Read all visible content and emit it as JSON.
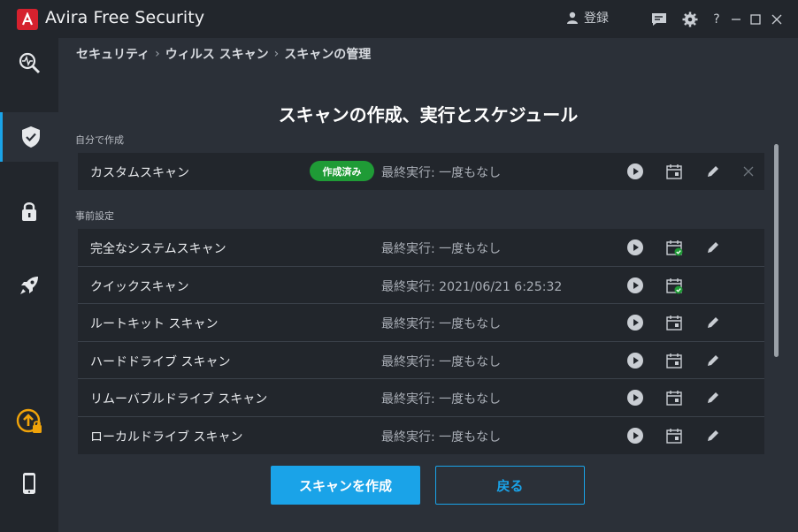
{
  "app": {
    "title_brand": "Avira",
    "title_product": "Free Security",
    "login_label": "登録"
  },
  "breadcrumb": [
    "セキュリティ",
    "ウィルス スキャン",
    "スキャンの管理"
  ],
  "page_title": "スキャンの作成、実行とスケジュール",
  "sections": {
    "custom_label": "自分で作成",
    "preset_label": "事前設定"
  },
  "custom_scans": [
    {
      "name": "カスタムスキャン",
      "badge": "作成済み",
      "status": "最終実行: 一度もなし"
    }
  ],
  "preset_scans": [
    {
      "name": "完全なシステムスキャン",
      "status": "最終実行: 一度もなし",
      "scheduled": true,
      "editable": true
    },
    {
      "name": "クイックスキャン",
      "status": "最終実行: 2021/06/21 6:25:32",
      "scheduled": true,
      "editable": false
    },
    {
      "name": "ルートキット スキャン",
      "status": "最終実行: 一度もなし",
      "scheduled": false,
      "editable": true
    },
    {
      "name": "ハードドライブ スキャン",
      "status": "最終実行: 一度もなし",
      "scheduled": false,
      "editable": true
    },
    {
      "name": "リムーバブルドライブ スキャン",
      "status": "最終実行: 一度もなし",
      "scheduled": false,
      "editable": true
    },
    {
      "name": "ローカルドライブ スキャン",
      "status": "最終実行: 一度もなし",
      "scheduled": false,
      "editable": true
    }
  ],
  "buttons": {
    "create": "スキャンを作成",
    "back": "戻る"
  },
  "colors": {
    "accent": "#1aa3e8",
    "brand": "#d5212e",
    "success": "#1f9b36"
  }
}
